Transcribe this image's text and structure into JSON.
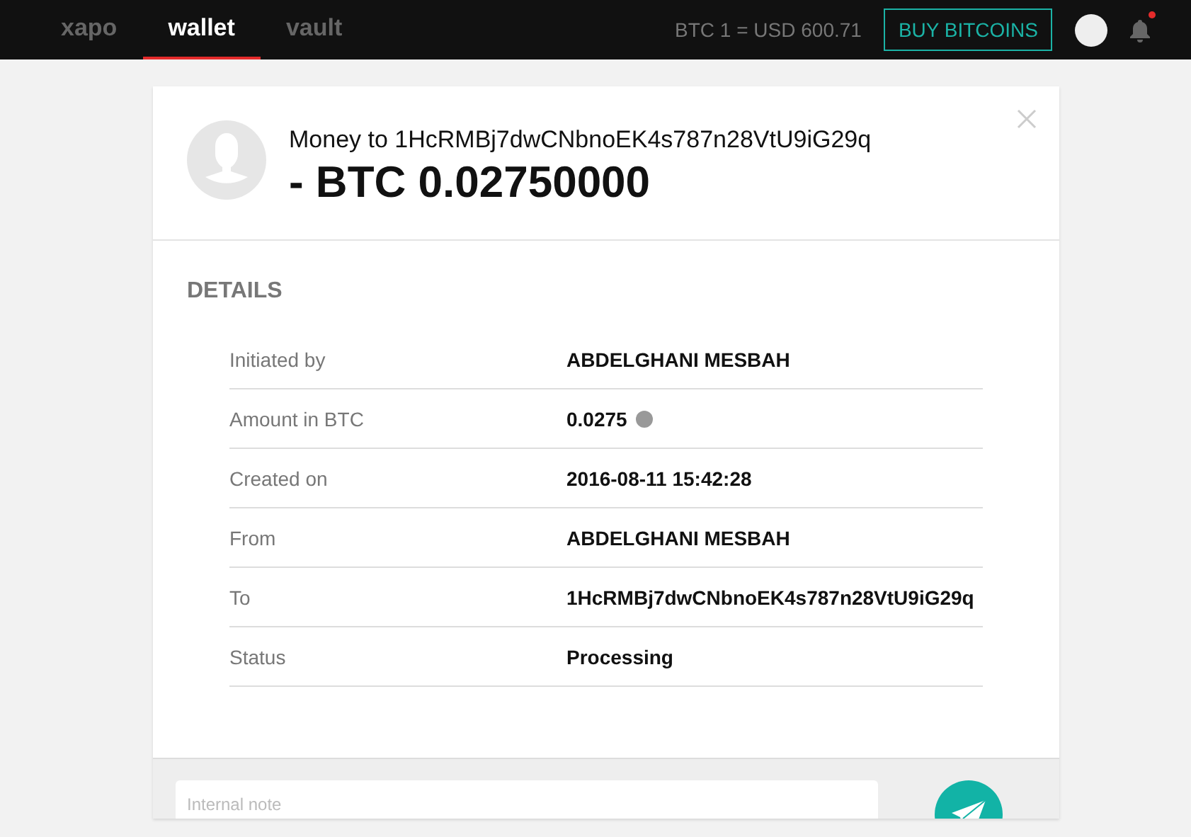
{
  "nav": {
    "tabs": [
      {
        "label": "xapo",
        "selected": false
      },
      {
        "label": "wallet",
        "selected": true
      },
      {
        "label": "vault",
        "selected": false
      }
    ],
    "rate": "BTC 1 = USD 600.71",
    "buy_button": "BUY BITCOINS",
    "notification_dot": true
  },
  "transaction": {
    "title": "Money to 1HcRMBj7dwCNbnoEK4s787n28VtU9iG29q",
    "amount": "- BTC 0.02750000"
  },
  "details": {
    "heading": "DETAILS",
    "rows": [
      {
        "label": "Initiated by",
        "value": "ABDELGHANI MESBAH",
        "info": false
      },
      {
        "label": "Amount in BTC",
        "value": "0.0275",
        "info": true
      },
      {
        "label": "Created on",
        "value": "2016-08-11 15:42:28",
        "info": false
      },
      {
        "label": "From",
        "value": "ABDELGHANI MESBAH",
        "info": false
      },
      {
        "label": "To",
        "value": "1HcRMBj7dwCNbnoEK4s787n28VtU9iG29q",
        "info": false
      },
      {
        "label": "Status",
        "value": "Processing",
        "info": false
      }
    ]
  },
  "note": {
    "placeholder": "Internal note"
  }
}
